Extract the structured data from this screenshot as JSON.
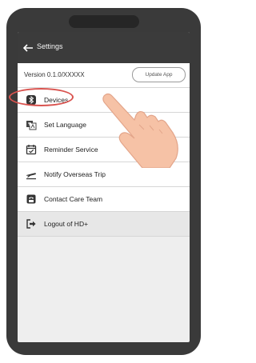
{
  "header": {
    "title": "Settings",
    "back_icon": "arrow-left-icon"
  },
  "version_bar": {
    "version": "Version 0.1.0/XXXXX",
    "update_button": "Update App"
  },
  "menu": {
    "items": [
      {
        "label": "Devices",
        "icon": "bluetooth-icon"
      },
      {
        "label": "Set Language",
        "icon": "language-icon"
      },
      {
        "label": "Reminder Service",
        "icon": "calendar-icon"
      },
      {
        "label": "Notify Overseas Trip",
        "icon": "airplane-icon"
      },
      {
        "label": "Contact Care Team",
        "icon": "phone-icon"
      },
      {
        "label": "Logout of HD+",
        "icon": "logout-icon"
      }
    ]
  },
  "colors": {
    "header_bg": "#3b3b3b",
    "highlight": "#d9534f",
    "hand_skin": "#f6c2a6"
  }
}
